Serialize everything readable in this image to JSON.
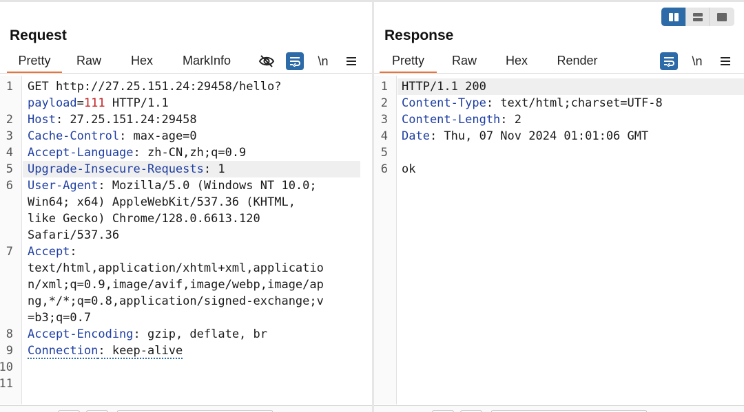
{
  "request": {
    "title": "Request",
    "tabs": [
      {
        "label": "Pretty",
        "active": true
      },
      {
        "label": "Raw",
        "active": false
      },
      {
        "label": "Hex",
        "active": false
      },
      {
        "label": "MarkInfo",
        "active": false
      }
    ],
    "tools": {
      "visibility": "eye-off-icon",
      "wrap": "word-wrap-icon",
      "newline_label": "\\n",
      "menu": "menu-icon"
    },
    "lines": [
      {
        "num": "1",
        "rows": [
          [
            {
              "t": "GET http://27.25.151.24:29458/hello?"
            }
          ],
          [
            {
              "t": "payload",
              "c": "p-name"
            },
            {
              "t": "="
            },
            {
              "t": "111",
              "c": "p-val"
            },
            {
              "t": " HTTP/1.1"
            }
          ]
        ]
      },
      {
        "num": "2",
        "rows": [
          [
            {
              "t": "Host",
              "c": "k"
            },
            {
              "t": ": 27.25.151.24:29458"
            }
          ]
        ]
      },
      {
        "num": "3",
        "rows": [
          [
            {
              "t": "Cache-Control",
              "c": "k"
            },
            {
              "t": ": max-age=0"
            }
          ]
        ]
      },
      {
        "num": "4",
        "rows": [
          [
            {
              "t": "Accept-Language",
              "c": "k"
            },
            {
              "t": ": zh-CN,zh;q=0.9"
            }
          ]
        ]
      },
      {
        "num": "5",
        "highlight": true,
        "rows": [
          [
            {
              "t": "Upgrade-Insecure-Requests",
              "c": "k"
            },
            {
              "t": ": 1"
            }
          ]
        ]
      },
      {
        "num": "6",
        "rows": [
          [
            {
              "t": "User-Agent",
              "c": "k"
            },
            {
              "t": ": Mozilla/5.0 (Windows NT 10.0;"
            }
          ],
          [
            {
              "t": "Win64; x64) AppleWebKit/537.36 (KHTML,"
            }
          ],
          [
            {
              "t": "like Gecko) Chrome/128.0.6613.120"
            }
          ],
          [
            {
              "t": "Safari/537.36"
            }
          ]
        ]
      },
      {
        "num": "7",
        "rows": [
          [
            {
              "t": "Accept",
              "c": "k"
            },
            {
              "t": ":"
            }
          ],
          [
            {
              "t": "text/html,application/xhtml+xml,applicatio"
            }
          ],
          [
            {
              "t": "n/xml;q=0.9,image/avif,image/webp,image/ap"
            }
          ],
          [
            {
              "t": "ng,*/*;q=0.8,application/signed-exchange;v"
            }
          ],
          [
            {
              "t": "=b3;q=0.7"
            }
          ]
        ]
      },
      {
        "num": "8",
        "rows": [
          [
            {
              "t": "Accept-Encoding",
              "c": "k"
            },
            {
              "t": ": gzip, deflate, br"
            }
          ]
        ]
      },
      {
        "num": "9",
        "rows": [
          [
            {
              "t": "Connection",
              "c": "k dotted"
            },
            {
              "t": ": keep-alive",
              "c": "dotted"
            }
          ]
        ]
      },
      {
        "num": "10",
        "rows": [
          [
            {
              "t": ""
            }
          ]
        ]
      },
      {
        "num": "11",
        "rows": [
          [
            {
              "t": ""
            }
          ]
        ]
      }
    ]
  },
  "response": {
    "title": "Response",
    "tabs": [
      {
        "label": "Pretty",
        "active": true
      },
      {
        "label": "Raw",
        "active": false
      },
      {
        "label": "Hex",
        "active": false
      },
      {
        "label": "Render",
        "active": false
      }
    ],
    "tools": {
      "wrap": "word-wrap-icon",
      "newline_label": "\\n",
      "menu": "menu-icon"
    },
    "lines": [
      {
        "num": "1",
        "highlight": true,
        "rows": [
          [
            {
              "t": "HTTP/1.1 200"
            }
          ]
        ]
      },
      {
        "num": "2",
        "rows": [
          [
            {
              "t": "Content-Type",
              "c": "k"
            },
            {
              "t": ": text/html;charset=UTF-8"
            }
          ]
        ]
      },
      {
        "num": "3",
        "rows": [
          [
            {
              "t": "Content-Length",
              "c": "k"
            },
            {
              "t": ": 2"
            }
          ]
        ]
      },
      {
        "num": "4",
        "rows": [
          [
            {
              "t": "Date",
              "c": "k"
            },
            {
              "t": ": Thu, 07 Nov 2024 01:01:06 GMT"
            }
          ]
        ]
      },
      {
        "num": "5",
        "rows": [
          [
            {
              "t": ""
            }
          ]
        ]
      },
      {
        "num": "6",
        "rows": [
          [
            {
              "t": "ok"
            }
          ]
        ]
      }
    ]
  },
  "layout_toggle": {
    "options": [
      "split-columns-icon",
      "split-rows-icon",
      "single-pane-icon"
    ],
    "active": "split-columns-icon"
  },
  "colors": {
    "accent": "#2d6aa8",
    "active_tab": "#e8743b",
    "header_key": "#1f3fa3",
    "param_value": "#c21f1f",
    "highlight_row": "#efefef"
  }
}
